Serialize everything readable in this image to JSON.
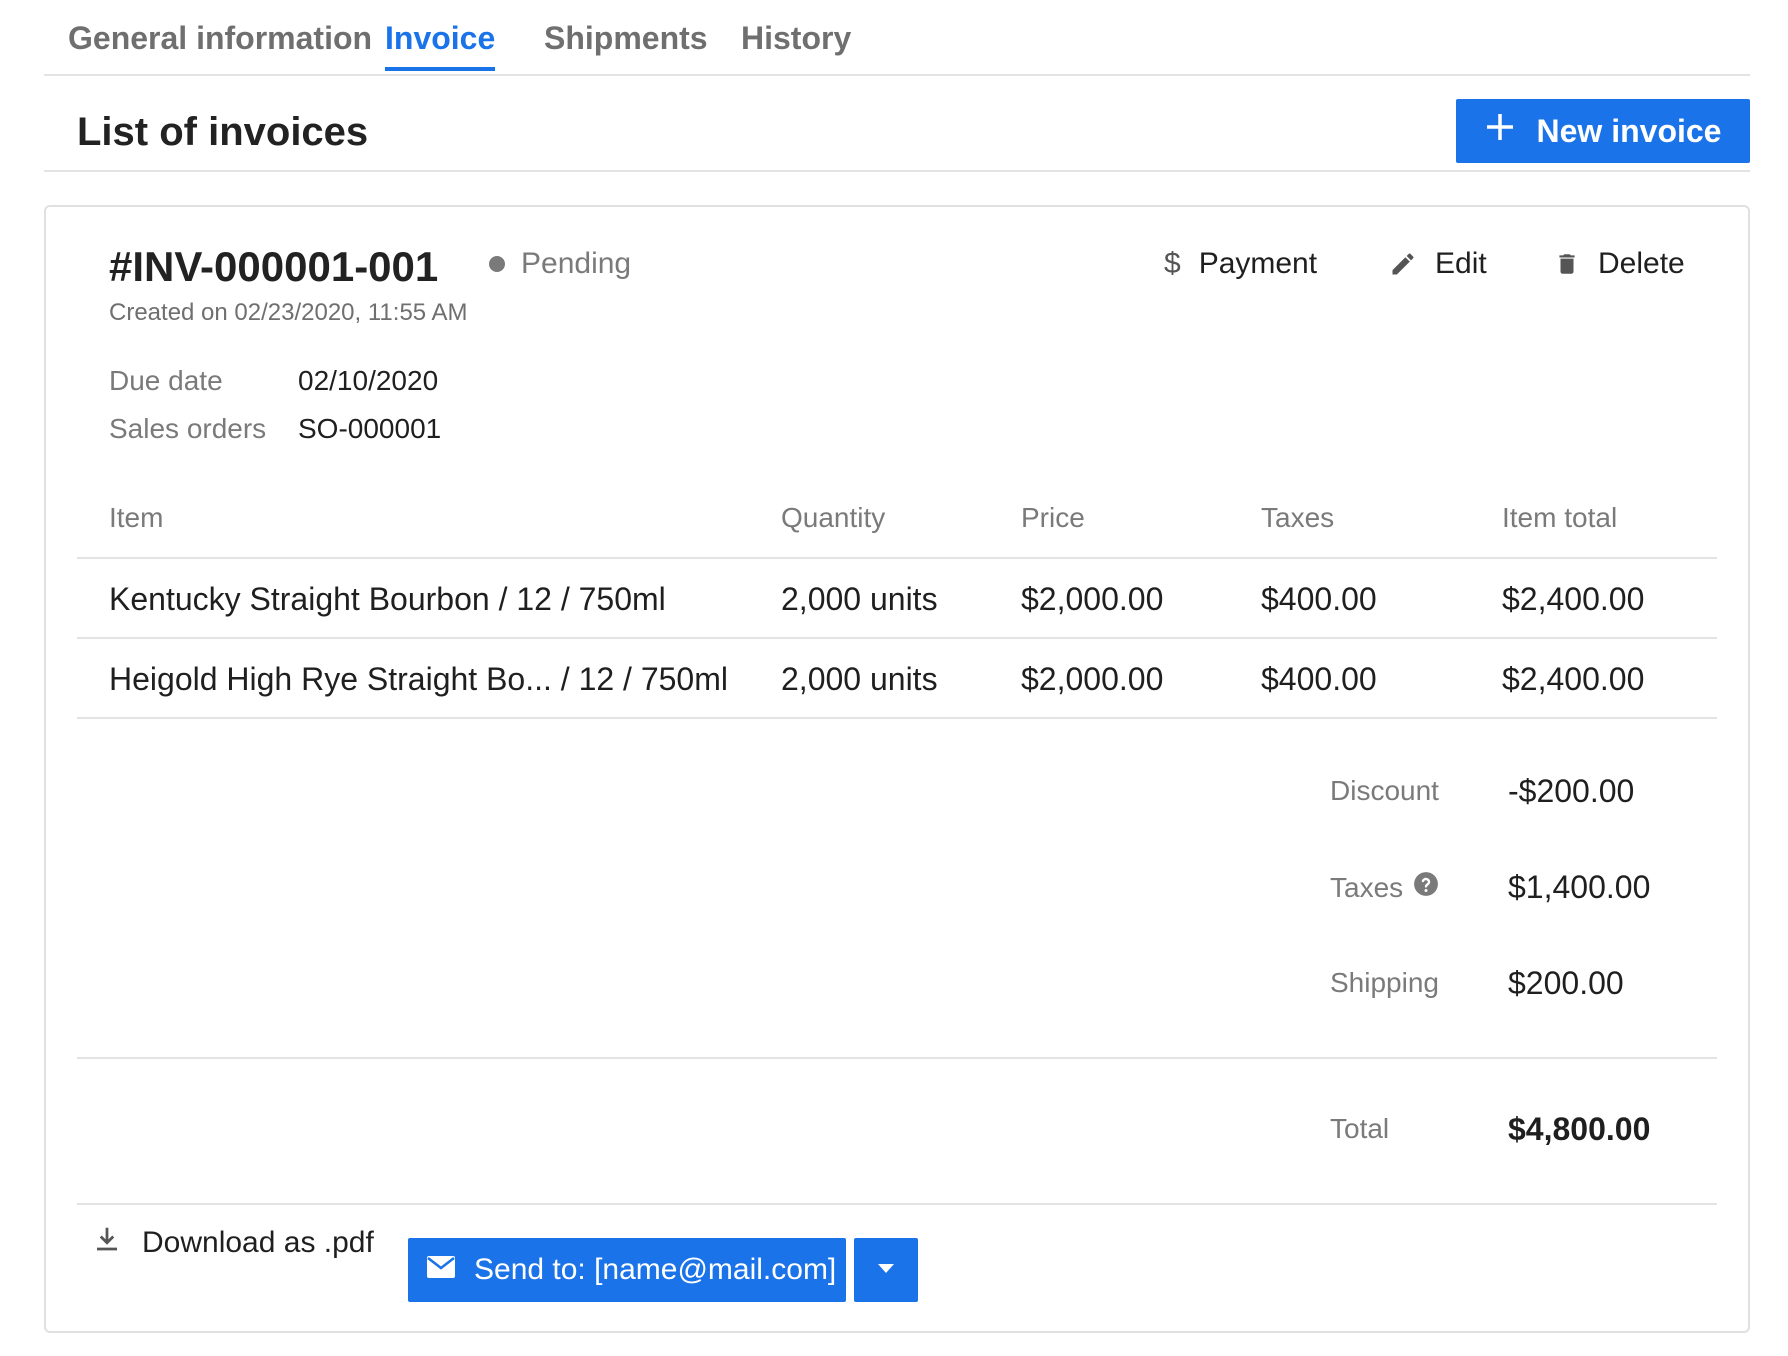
{
  "tabs": [
    {
      "label": "General information"
    },
    {
      "label": "Invoice"
    },
    {
      "label": "Shipments"
    },
    {
      "label": "History"
    }
  ],
  "header": {
    "title": "List of invoices",
    "new_invoice_label": "New invoice"
  },
  "invoice": {
    "number": "#INV-000001-001",
    "status": "Pending",
    "created": "Created on 02/23/2020, 11:55 AM",
    "due_date_label": "Due date",
    "due_date": "02/10/2020",
    "sales_orders_label": "Sales orders",
    "sales_orders": "SO-000001",
    "actions": {
      "payment": "Payment",
      "edit": "Edit",
      "delete": "Delete"
    }
  },
  "table": {
    "headers": [
      "Item",
      "Quantity",
      "Price",
      "Taxes",
      "Item total"
    ],
    "rows": [
      [
        "Kentucky Straight Bourbon / 12 / 750ml",
        "2,000 units",
        "$2,000.00",
        "$400.00",
        "$2,400.00"
      ],
      [
        "Heigold High Rye Straight Bo... / 12 / 750ml",
        "2,000 units",
        "$2,000.00",
        "$400.00",
        "$2,400.00"
      ]
    ]
  },
  "summary": {
    "discount_label": "Discount",
    "discount": "-$200.00",
    "taxes_label": "Taxes",
    "taxes": "$1,400.00",
    "shipping_label": "Shipping",
    "shipping": "$200.00",
    "total_label": "Total",
    "total": "$4,800.00"
  },
  "footer": {
    "download_label": "Download as .pdf",
    "send_label": "Send to: [name@mail.com]"
  },
  "colors": {
    "accent": "#1a73e8",
    "muted_text": "#7a7a7a",
    "divider": "#e3e3e3"
  }
}
